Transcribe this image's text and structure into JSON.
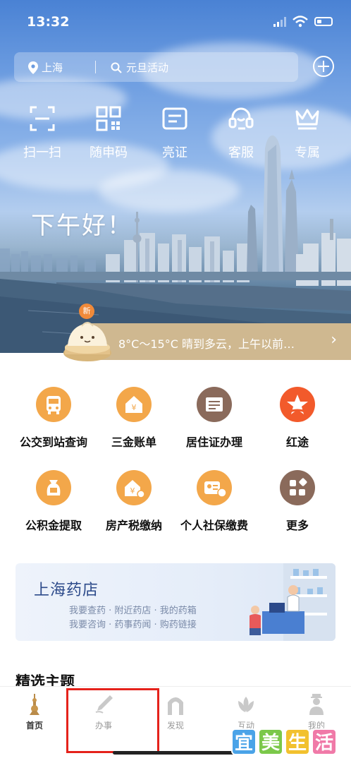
{
  "status_bar": {
    "time": "13:32"
  },
  "top": {
    "location": "上海",
    "search_placeholder": "元旦活动"
  },
  "quick_actions": [
    {
      "label": "扫一扫",
      "icon": "scan-icon"
    },
    {
      "label": "随申码",
      "icon": "qr-code-icon"
    },
    {
      "label": "亮证",
      "icon": "id-card-icon"
    },
    {
      "label": "客服",
      "icon": "headset-icon"
    },
    {
      "label": "专属",
      "icon": "crown-icon"
    }
  ],
  "greeting": "下午好！",
  "weather": {
    "badge": "新",
    "text": "8°C～15°C 晴到多云，上午以前…"
  },
  "services": [
    {
      "label": "公交到站查询",
      "icon": "bus-icon",
      "color": "#f3a74a"
    },
    {
      "label": "三金账单",
      "icon": "money-house-icon",
      "color": "#f3a74a"
    },
    {
      "label": "居住证办理",
      "icon": "residence-card-icon",
      "color": "#8a6a5b"
    },
    {
      "label": "红途",
      "icon": "red-star-icon",
      "color": "#f25a2b"
    },
    {
      "label": "公积金提取",
      "icon": "fund-bag-icon",
      "color": "#f3a74a"
    },
    {
      "label": "房产税缴纳",
      "icon": "property-tax-icon",
      "color": "#f3a74a"
    },
    {
      "label": "个人社保缴费",
      "icon": "social-security-icon",
      "color": "#f3a74a"
    },
    {
      "label": "更多",
      "icon": "more-grid-icon",
      "color": "#8a6a5b"
    }
  ],
  "banner": {
    "title": "上海药店",
    "line1": "我要查药 · 附近药店 · 我的药箱",
    "line2": "我要咨询 · 药事药闻 · 购药链接"
  },
  "section_title": "精选主题",
  "tabs": [
    {
      "label": "首页",
      "icon": "home-tower-icon",
      "active": true
    },
    {
      "label": "办事",
      "icon": "pen-icon",
      "active": false
    },
    {
      "label": "发现",
      "icon": "arch-icon",
      "active": false
    },
    {
      "label": "互动",
      "icon": "lotus-icon",
      "active": false
    },
    {
      "label": "我的",
      "icon": "person-icon",
      "active": false
    }
  ],
  "watermark": [
    "宜",
    "美",
    "生",
    "活"
  ],
  "colors": {
    "accent_orange": "#f3a74a",
    "weather_strip": "#cfb890",
    "highlight_box": "#e5221b"
  }
}
